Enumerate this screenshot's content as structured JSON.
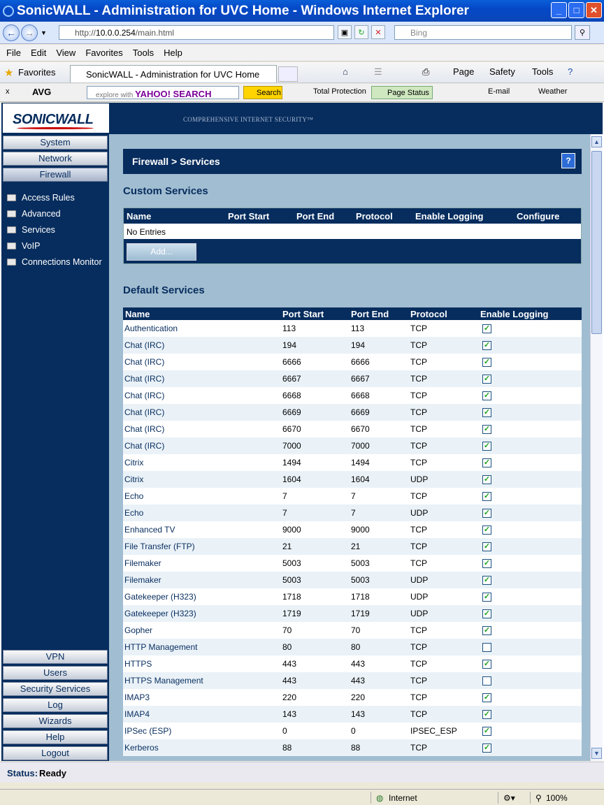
{
  "window": {
    "title": "SonicWALL - Administration for UVC Home - Windows Internet Explorer"
  },
  "address": {
    "url_prefix": "http://",
    "url_host": "10.0.0.254",
    "url_path": "/main.html",
    "search_placeholder": "Bing"
  },
  "menu": [
    "File",
    "Edit",
    "View",
    "Favorites",
    "Tools",
    "Help"
  ],
  "favbar": {
    "favorites": "Favorites",
    "tab_title": "SonicWALL - Administration for UVC Home",
    "page": "Page",
    "safety": "Safety",
    "tools": "Tools"
  },
  "avgbar": {
    "avg": "AVG",
    "explore": "explore with",
    "yahoo": "YAHOO! SEARCH",
    "search": "Search",
    "total_protection": "Total Protection",
    "page_status": "Page Status",
    "email": "E-mail",
    "weather": "Weather"
  },
  "brand": {
    "logo": "SONICWALL",
    "slogan": "COMPREHENSIVE INTERNET SECURITY™"
  },
  "sidebar": {
    "top": [
      "System",
      "Network",
      "Firewall"
    ],
    "sub": [
      "Access Rules",
      "Advanced",
      "Services",
      "VoIP",
      "Connections Monitor"
    ],
    "bottom": [
      "VPN",
      "Users",
      "Security Services",
      "Log",
      "Wizards",
      "Help",
      "Logout"
    ]
  },
  "main": {
    "heading": "Firewall > Services",
    "help": "?",
    "custom_title": "Custom Services",
    "custom_columns": [
      "Name",
      "Port Start",
      "Port End",
      "Protocol",
      "Enable Logging",
      "Configure"
    ],
    "no_entries": "No Entries",
    "add": "Add...",
    "default_title": "Default Services",
    "default_columns": [
      "Name",
      "Port Start",
      "Port End",
      "Protocol",
      "Enable Logging"
    ],
    "rows": [
      [
        "Authentication",
        "113",
        "113",
        "TCP",
        true
      ],
      [
        "Chat (IRC)",
        "194",
        "194",
        "TCP",
        true
      ],
      [
        "Chat (IRC)",
        "6666",
        "6666",
        "TCP",
        true
      ],
      [
        "Chat (IRC)",
        "6667",
        "6667",
        "TCP",
        true
      ],
      [
        "Chat (IRC)",
        "6668",
        "6668",
        "TCP",
        true
      ],
      [
        "Chat (IRC)",
        "6669",
        "6669",
        "TCP",
        true
      ],
      [
        "Chat (IRC)",
        "6670",
        "6670",
        "TCP",
        true
      ],
      [
        "Chat (IRC)",
        "7000",
        "7000",
        "TCP",
        true
      ],
      [
        "Citrix",
        "1494",
        "1494",
        "TCP",
        true
      ],
      [
        "Citrix",
        "1604",
        "1604",
        "UDP",
        true
      ],
      [
        "Echo",
        "7",
        "7",
        "TCP",
        true
      ],
      [
        "Echo",
        "7",
        "7",
        "UDP",
        true
      ],
      [
        "Enhanced TV",
        "9000",
        "9000",
        "TCP",
        true
      ],
      [
        "File Transfer (FTP)",
        "21",
        "21",
        "TCP",
        true
      ],
      [
        "Filemaker",
        "5003",
        "5003",
        "TCP",
        true
      ],
      [
        "Filemaker",
        "5003",
        "5003",
        "UDP",
        true
      ],
      [
        "Gatekeeper (H323)",
        "1718",
        "1718",
        "UDP",
        true
      ],
      [
        "Gatekeeper (H323)",
        "1719",
        "1719",
        "UDP",
        true
      ],
      [
        "Gopher",
        "70",
        "70",
        "TCP",
        true
      ],
      [
        "HTTP Management",
        "80",
        "80",
        "TCP",
        false
      ],
      [
        "HTTPS",
        "443",
        "443",
        "TCP",
        true
      ],
      [
        "HTTPS Management",
        "443",
        "443",
        "TCP",
        false
      ],
      [
        "IMAP3",
        "220",
        "220",
        "TCP",
        true
      ],
      [
        "IMAP4",
        "143",
        "143",
        "TCP",
        true
      ],
      [
        "IPSec (ESP)",
        "0",
        "0",
        "IPSEC_ESP",
        true
      ],
      [
        "Kerberos",
        "88",
        "88",
        "TCP",
        true
      ]
    ]
  },
  "status": {
    "label": "Status:",
    "value": "Ready"
  },
  "iestatus": {
    "zone": "Internet",
    "zoom": "100%"
  }
}
